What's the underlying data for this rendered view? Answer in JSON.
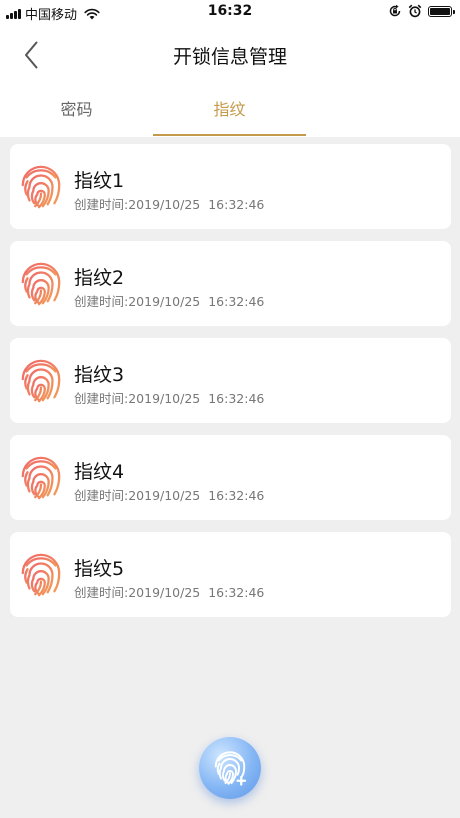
{
  "status_bar": {
    "carrier": "中国移动",
    "time": "16:32"
  },
  "header": {
    "title": "开锁信息管理"
  },
  "tabs": [
    {
      "label": "密码",
      "active": false
    },
    {
      "label": "指纹",
      "active": true
    }
  ],
  "fingerprints": [
    {
      "name": "指纹1",
      "created": "创建时间:2019/10/25  16:32:46"
    },
    {
      "name": "指纹2",
      "created": "创建时间:2019/10/25  16:32:46"
    },
    {
      "name": "指纹3",
      "created": "创建时间:2019/10/25  16:32:46"
    },
    {
      "name": "指纹4",
      "created": "创建时间:2019/10/25  16:32:46"
    },
    {
      "name": "指纹5",
      "created": "创建时间:2019/10/25  16:32:46"
    }
  ],
  "colors": {
    "accent": "#c49a4a",
    "fingerprint_start": "#f06a6a",
    "fingerprint_end": "#f29a58",
    "fab": "#84b6f4"
  },
  "icons": {
    "back": "chevron-left-icon",
    "fingerprint": "fingerprint-icon",
    "add_fingerprint": "fingerprint-add-icon"
  }
}
